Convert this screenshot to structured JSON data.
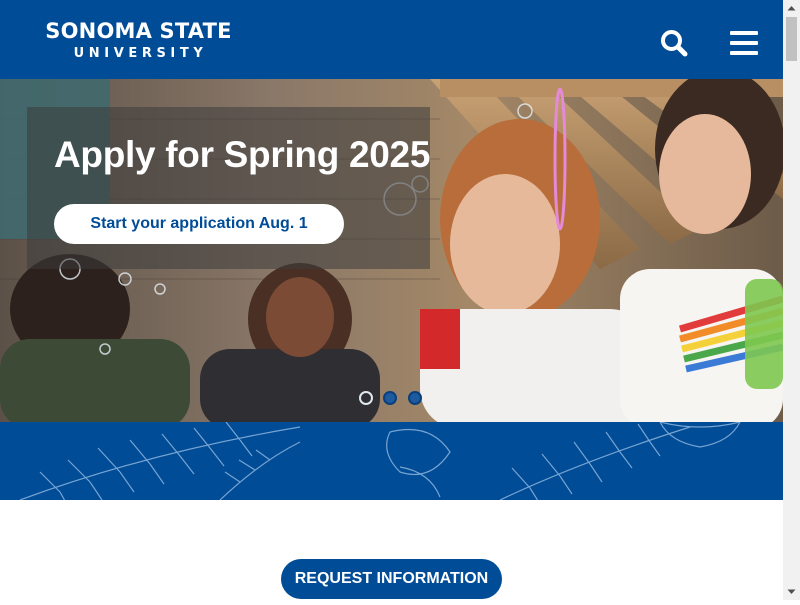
{
  "header": {
    "logo_line1": "SONOMA STATE",
    "logo_line2": "UNIVERSITY",
    "search_icon": "search-icon",
    "menu_icon": "hamburger-menu-icon"
  },
  "hero": {
    "title": "Apply for Spring 2025",
    "cta_label": "Start your application Aug. 1",
    "slides": [
      {
        "active": true
      },
      {
        "active": false
      },
      {
        "active": false
      }
    ]
  },
  "request_info": {
    "label": "REQUEST INFORMATION"
  },
  "colors": {
    "brand_blue": "#004c97",
    "white": "#ffffff"
  }
}
